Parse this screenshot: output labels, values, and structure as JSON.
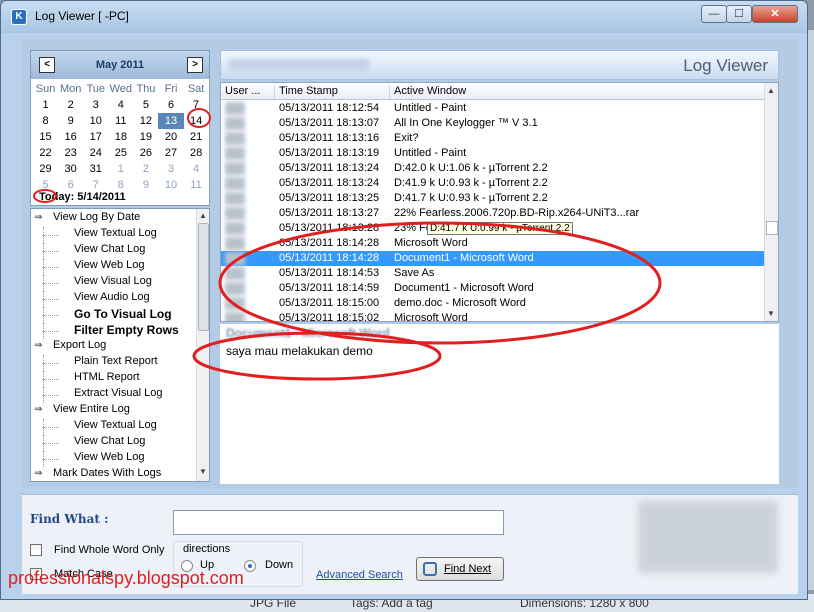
{
  "background": {
    "items": [
      "JPG File",
      "Tags: Add a tag",
      "Dimensions: 1280 x 800"
    ]
  },
  "window": {
    "title": "Log Viewer [        -PC]",
    "controls": {
      "minimize": "—",
      "maximize": "☐",
      "close": "✕"
    }
  },
  "calendar": {
    "month": "May 2011",
    "prev": "<",
    "next": ">",
    "weekdays": [
      "Sun",
      "Mon",
      "Tue",
      "Wed",
      "Thu",
      "Fri",
      "Sat"
    ],
    "weeks": [
      [
        "1",
        "2",
        "3",
        "4",
        "5",
        "6",
        "7"
      ],
      [
        "8",
        "9",
        "10",
        "11",
        "12",
        "13",
        "14"
      ],
      [
        "15",
        "16",
        "17",
        "18",
        "19",
        "20",
        "21"
      ],
      [
        "22",
        "23",
        "24",
        "25",
        "26",
        "27",
        "28"
      ],
      [
        "29",
        "30",
        "31",
        "1",
        "2",
        "3",
        "4"
      ],
      [
        "5",
        "6",
        "7",
        "8",
        "9",
        "10",
        "11"
      ]
    ],
    "selected": "13",
    "today_circled": "14",
    "today_label": "Today: 5/14/2011"
  },
  "tree": {
    "items": [
      {
        "label": "View Log By Date",
        "level": 0
      },
      {
        "label": "View Textual Log",
        "level": 1
      },
      {
        "label": "View Chat Log",
        "level": 1
      },
      {
        "label": "View Web Log",
        "level": 1
      },
      {
        "label": "View Visual Log",
        "level": 1
      },
      {
        "label": "View Audio Log",
        "level": 1
      },
      {
        "label": "Go To Visual Log",
        "level": 1,
        "bold": true
      },
      {
        "label": "Filter Empty Rows",
        "level": 1,
        "bold": true
      },
      {
        "label": "Export Log",
        "level": 0
      },
      {
        "label": "Plain Text Report",
        "level": 1
      },
      {
        "label": "HTML Report",
        "level": 1
      },
      {
        "label": "Extract Visual Log",
        "level": 1
      },
      {
        "label": "View Entire Log",
        "level": 0
      },
      {
        "label": "View Textual Log",
        "level": 1
      },
      {
        "label": "View Chat Log",
        "level": 1
      },
      {
        "label": "View Web Log",
        "level": 1
      },
      {
        "label": "Mark Dates With Logs",
        "level": 0
      }
    ]
  },
  "main": {
    "header_title": "Log Viewer",
    "columns": [
      "User ...",
      "Time Stamp",
      "Active Window"
    ],
    "rows": [
      {
        "time": "05/13/2011 18:12:54",
        "window": "Untitled - Paint"
      },
      {
        "time": "05/13/2011 18:13:07",
        "window": "All In One Keylogger ™ V 3.1"
      },
      {
        "time": "05/13/2011 18:13:16",
        "window": "Exit?"
      },
      {
        "time": "05/13/2011 18:13:19",
        "window": "Untitled - Paint"
      },
      {
        "time": "05/13/2011 18:13:24",
        "window": "D:42.0 k U:1.06 k - µTorrent 2.2"
      },
      {
        "time": "05/13/2011 18:13:24",
        "window": "D:41.9 k U:0.93 k - µTorrent 2.2"
      },
      {
        "time": "05/13/2011 18:13:25",
        "window": "D:41.7 k U:0.93 k - µTorrent 2.2"
      },
      {
        "time": "05/13/2011 18:13:27",
        "window": "22% Fearless.2006.720p.BD-Rip.x264-UNiT3...rar"
      },
      {
        "time": "05/13/2011 18:13:28",
        "window": "23% Fe"
      },
      {
        "time": "05/13/2011 18:14:28",
        "window": "Microsoft Word"
      },
      {
        "time": "05/13/2011 18:14:28",
        "window": "Document1 - Microsoft Word",
        "selected": true
      },
      {
        "time": "05/13/2011 18:14:53",
        "window": "Save As"
      },
      {
        "time": "05/13/2011 18:14:59",
        "window": "Document1 - Microsoft Word"
      },
      {
        "time": "05/13/2011 18:15:00",
        "window": "demo.doc - Microsoft Word"
      },
      {
        "time": "05/13/2011 18:15:02",
        "window": "Microsoft Word"
      }
    ],
    "tooltip": "D:41.7 k U:0.99 k - µTorrent 2.2",
    "detail_title": "Document1 - Microsoft Word",
    "detail_text": "saya mau melakukan demo"
  },
  "find": {
    "label": "Find What :",
    "value": "",
    "whole_word": "Find Whole Word Only",
    "match_case": "Match Case",
    "directions_label": "directions",
    "up": "Up",
    "down": "Down",
    "direction_selected": "Down",
    "advanced": "Advanced Search",
    "find_next": "Find Next"
  },
  "watermark": "professionalspy.blogspot.com",
  "colors": {
    "selection": "#3399ff",
    "annotation": "#e02020",
    "calendar_selected": "#5a86b8"
  }
}
